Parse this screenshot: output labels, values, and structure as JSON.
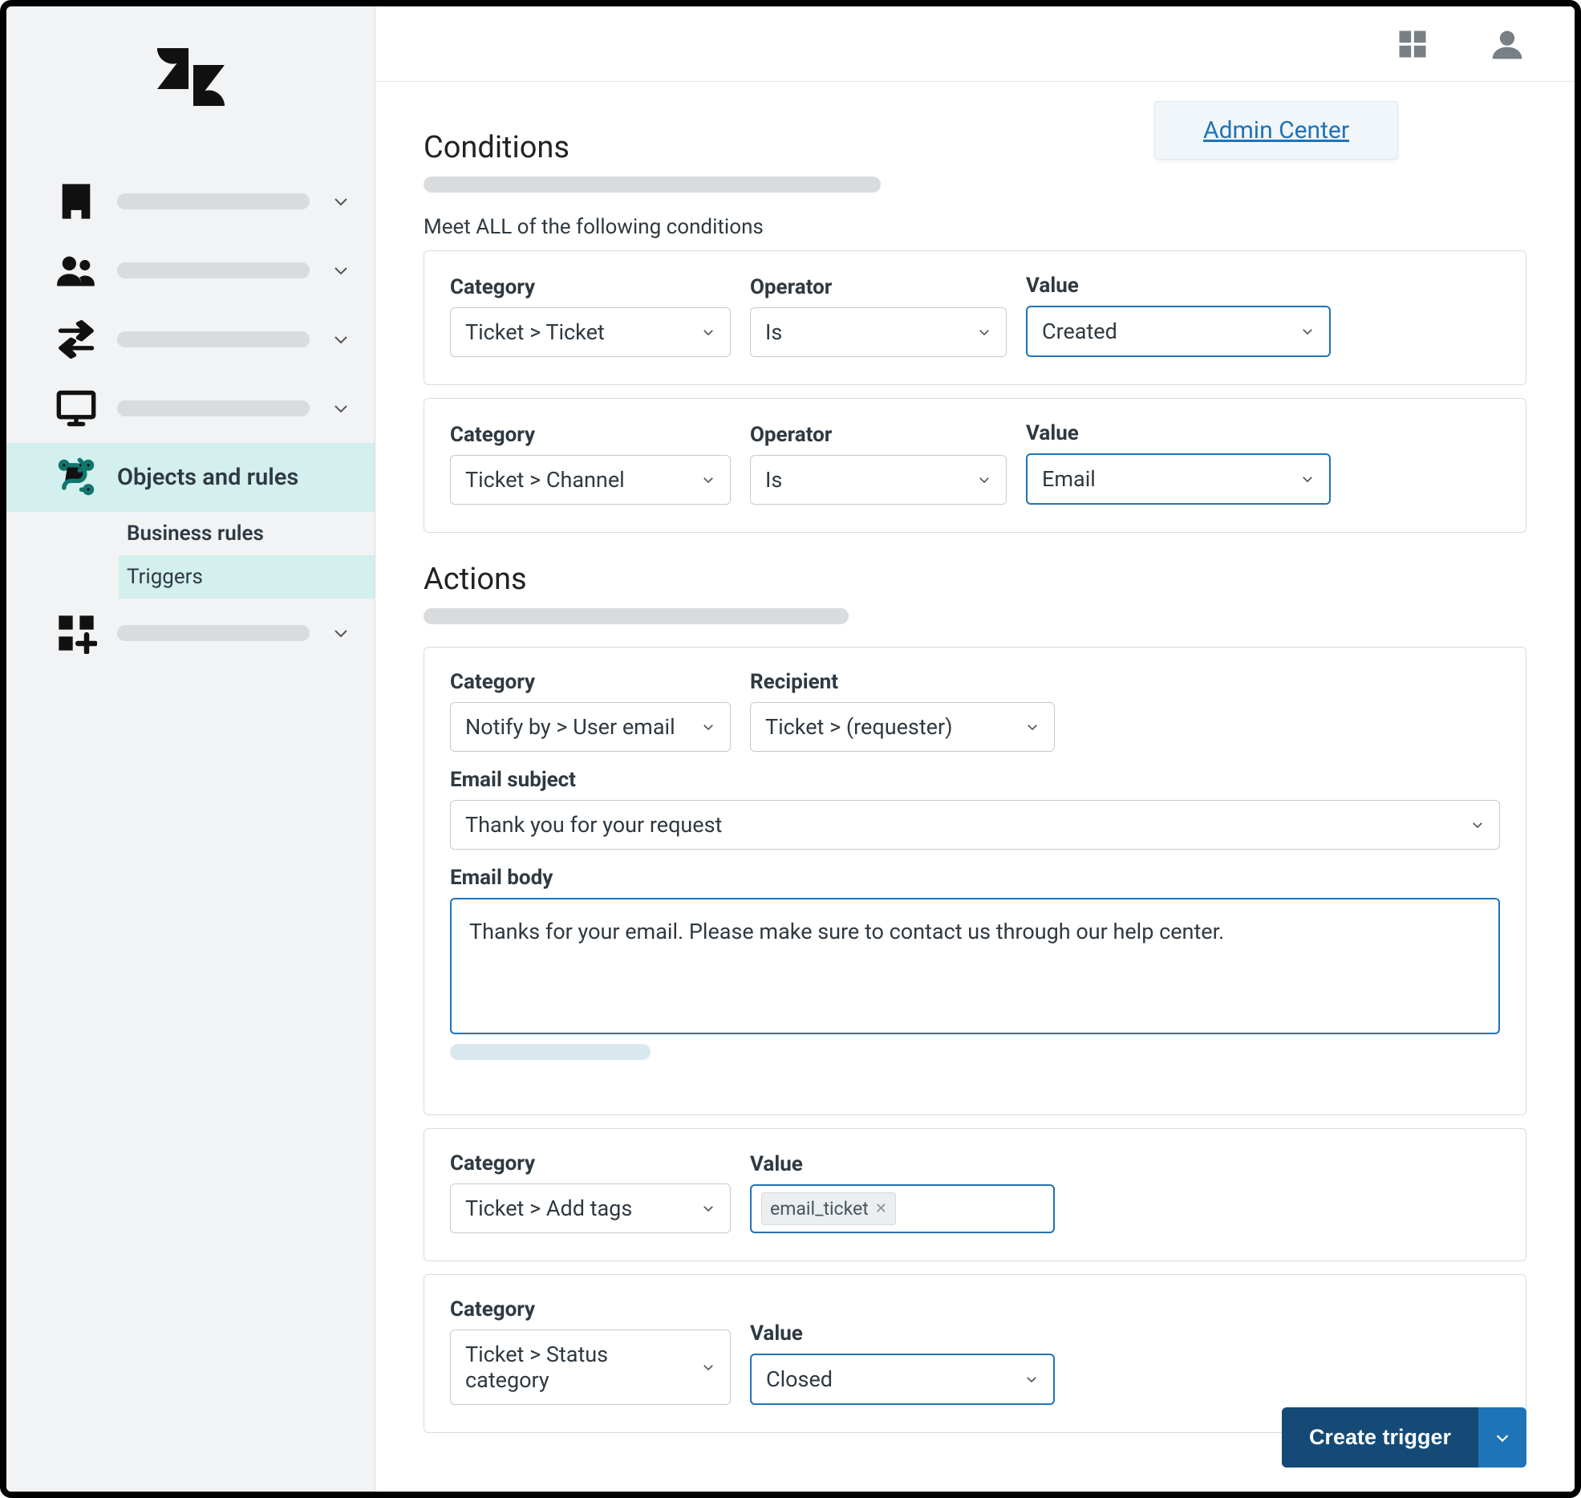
{
  "header": {
    "admin_center_link": "Admin Center"
  },
  "sidebar": {
    "active_section": {
      "label": "Objects and rules",
      "sub_section": "Business rules",
      "active_item": "Triggers"
    }
  },
  "conditions": {
    "title": "Conditions",
    "all_label": "Meet ALL of the following conditions",
    "labels": {
      "category": "Category",
      "operator": "Operator",
      "value": "Value"
    },
    "rows": [
      {
        "category": "Ticket > Ticket",
        "operator": "Is",
        "value": "Created"
      },
      {
        "category": "Ticket > Channel",
        "operator": "Is",
        "value": "Email"
      }
    ]
  },
  "actions": {
    "title": "Actions",
    "labels": {
      "category": "Category",
      "recipient": "Recipient",
      "value": "Value",
      "email_subject": "Email subject",
      "email_body": "Email body"
    },
    "notify": {
      "category": "Notify by > User email",
      "recipient": "Ticket > (requester)",
      "email_subject": "Thank you for your request",
      "email_body": "Thanks for your email. Please make sure to contact us through our help center."
    },
    "add_tags": {
      "category": "Ticket > Add tags",
      "tags": [
        "email_ticket"
      ]
    },
    "status": {
      "category": "Ticket > Status category",
      "value": "Closed"
    }
  },
  "footer": {
    "create_label": "Create trigger"
  }
}
